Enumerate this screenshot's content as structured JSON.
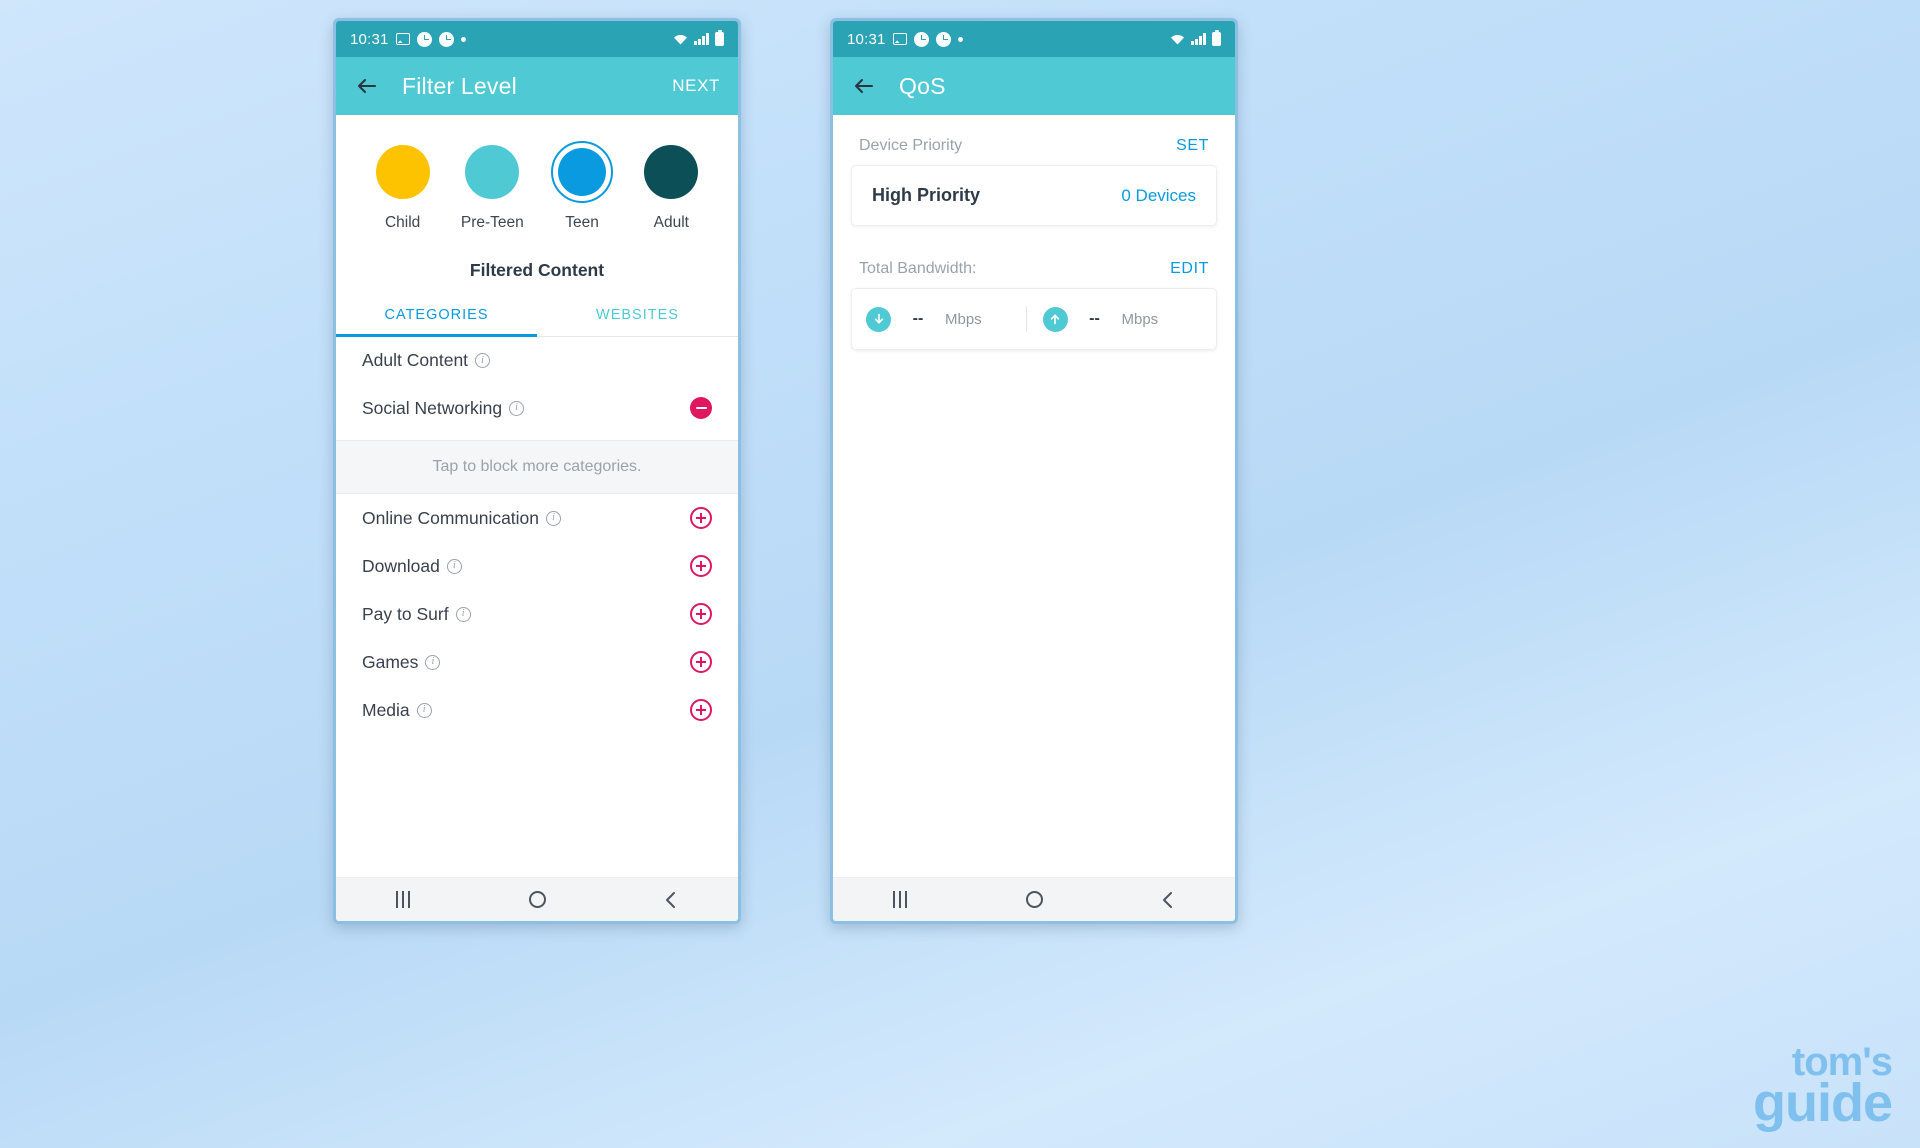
{
  "background": {
    "accent_blue": "#0a9ae0",
    "teal": "#4fc9d3",
    "teal_dark": "#2aa3b5",
    "pink": "#e0165f"
  },
  "phones": {
    "left": {
      "statusbar": {
        "time": "10:31",
        "left_icons": [
          "image-icon",
          "clock-icon",
          "clock-icon",
          "dot-icon"
        ],
        "right_icons": [
          "wifi-icon",
          "signal-icon",
          "battery-icon"
        ]
      },
      "appbar": {
        "back": "back-arrow-icon",
        "title": "Filter Level",
        "action": "NEXT"
      },
      "levels": [
        {
          "label": "Child",
          "color": "#fdc300",
          "selected": false
        },
        {
          "label": "Pre-Teen",
          "color": "#4fc9d3",
          "selected": false
        },
        {
          "label": "Teen",
          "color": "#0a9ae0",
          "selected": true
        },
        {
          "label": "Adult",
          "color": "#0d4f57",
          "selected": false
        }
      ],
      "section_title": "Filtered Content",
      "tabs": [
        {
          "label": "CATEGORIES",
          "active": true
        },
        {
          "label": "WEBSITES",
          "active": false
        }
      ],
      "blocked_categories": [
        {
          "name": "Adult Content",
          "action": "none"
        },
        {
          "name": "Social Networking",
          "action": "minus"
        }
      ],
      "hint": "Tap to block more categories.",
      "available_categories": [
        {
          "name": "Online Communication",
          "action": "plus"
        },
        {
          "name": "Download",
          "action": "plus"
        },
        {
          "name": "Pay to Surf",
          "action": "plus"
        },
        {
          "name": "Games",
          "action": "plus"
        },
        {
          "name": "Media",
          "action": "plus"
        }
      ],
      "navbar": [
        "recent-apps-icon",
        "home-icon",
        "back-icon"
      ]
    },
    "right": {
      "statusbar": {
        "time": "10:31",
        "left_icons": [
          "image-icon",
          "clock-icon",
          "clock-icon",
          "dot-icon"
        ],
        "right_icons": [
          "wifi-icon",
          "signal-icon",
          "battery-icon"
        ]
      },
      "appbar": {
        "back": "back-arrow-icon",
        "title": "QoS",
        "action": ""
      },
      "device_priority": {
        "label": "Device Priority",
        "action": "SET",
        "card_title": "High Priority",
        "card_value": "0 Devices"
      },
      "total_bandwidth": {
        "label": "Total Bandwidth:",
        "action": "EDIT",
        "download": {
          "icon": "download-arrow-icon",
          "value": "--",
          "unit": "Mbps"
        },
        "upload": {
          "icon": "upload-arrow-icon",
          "value": "--",
          "unit": "Mbps"
        }
      },
      "navbar": [
        "recent-apps-icon",
        "home-icon",
        "back-icon"
      ]
    }
  },
  "watermark": {
    "line1": "tom's",
    "line2": "guide"
  }
}
